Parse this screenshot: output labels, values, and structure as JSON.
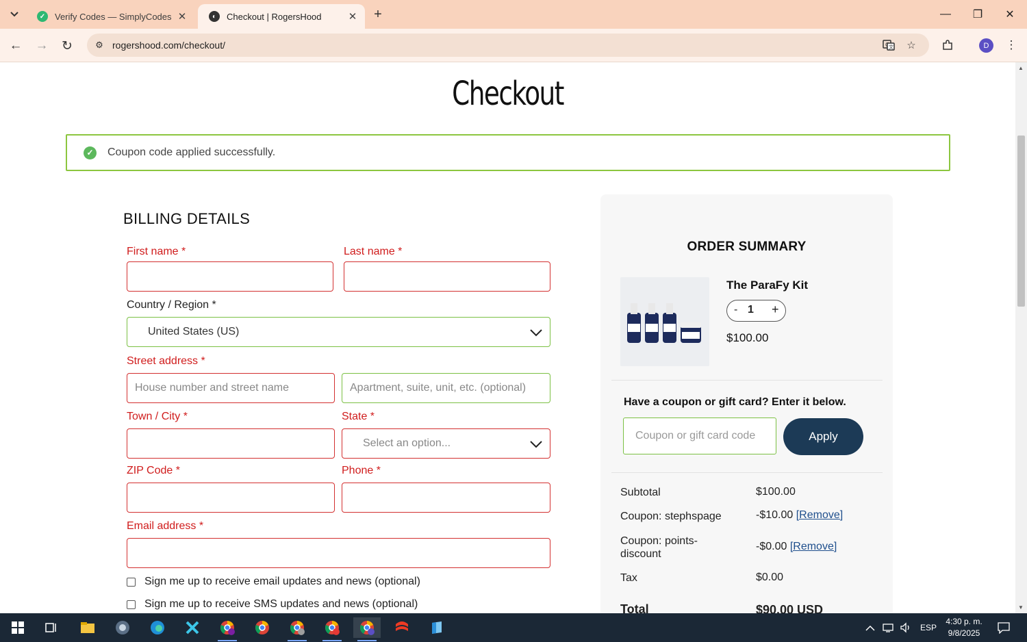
{
  "browser": {
    "tabs": [
      {
        "title": "Verify Codes — SimplyCodes",
        "favicon": "simplycodes-icon",
        "active": false
      },
      {
        "title": "Checkout | RogersHood",
        "favicon": "rogershood-icon",
        "active": true
      }
    ],
    "url": "rogershood.com/checkout/",
    "profile_initial": "D"
  },
  "page": {
    "title": "Checkout",
    "notice": "Coupon code applied successfully.",
    "billing": {
      "heading": "BILLING DETAILS",
      "first_name_label": "First name *",
      "last_name_label": "Last name *",
      "country_label": "Country / Region *",
      "country_value": "United States (US)",
      "street_label": "Street address *",
      "street_placeholder": "House number and street name",
      "apt_placeholder": "Apartment, suite, unit, etc. (optional)",
      "city_label": "Town / City *",
      "state_label": "State *",
      "state_placeholder": "Select an option...",
      "zip_label": "ZIP Code *",
      "phone_label": "Phone *",
      "email_label": "Email address *",
      "email_optin": "Sign me up to receive email updates and news (optional)",
      "sms_optin": "Sign me up to receive SMS updates and news (optional)"
    },
    "summary": {
      "heading": "ORDER SUMMARY",
      "product_name": "The ParaFy Kit",
      "quantity": "1",
      "qty_minus": "-",
      "qty_plus": "+",
      "product_price": "$100.00",
      "coupon_prompt": "Have a coupon or gift card? Enter it below.",
      "coupon_placeholder": "Coupon or gift card code",
      "apply_label": "Apply",
      "subtotal_label": "Subtotal",
      "subtotal_value": "$100.00",
      "coupon1_label": "Coupon: stephspage",
      "coupon1_value": "-$10.00",
      "coupon2_label": "Coupon: points-discount",
      "coupon2_value": "-$0.00",
      "remove_label": "[Remove]",
      "tax_label": "Tax",
      "tax_value": "$0.00",
      "total_label": "Total",
      "total_value": "$90.00 USD"
    }
  },
  "taskbar": {
    "language": "ESP",
    "time": "4:30 p. m.",
    "date": "9/8/2025"
  },
  "colors": {
    "tabstrip": "#f9d3bd",
    "toolbar": "#fdf1ea",
    "error_red": "#d01c1c",
    "success_green": "#8cc63f",
    "apply_button": "#1c3a56",
    "taskbar": "#1b2836"
  }
}
